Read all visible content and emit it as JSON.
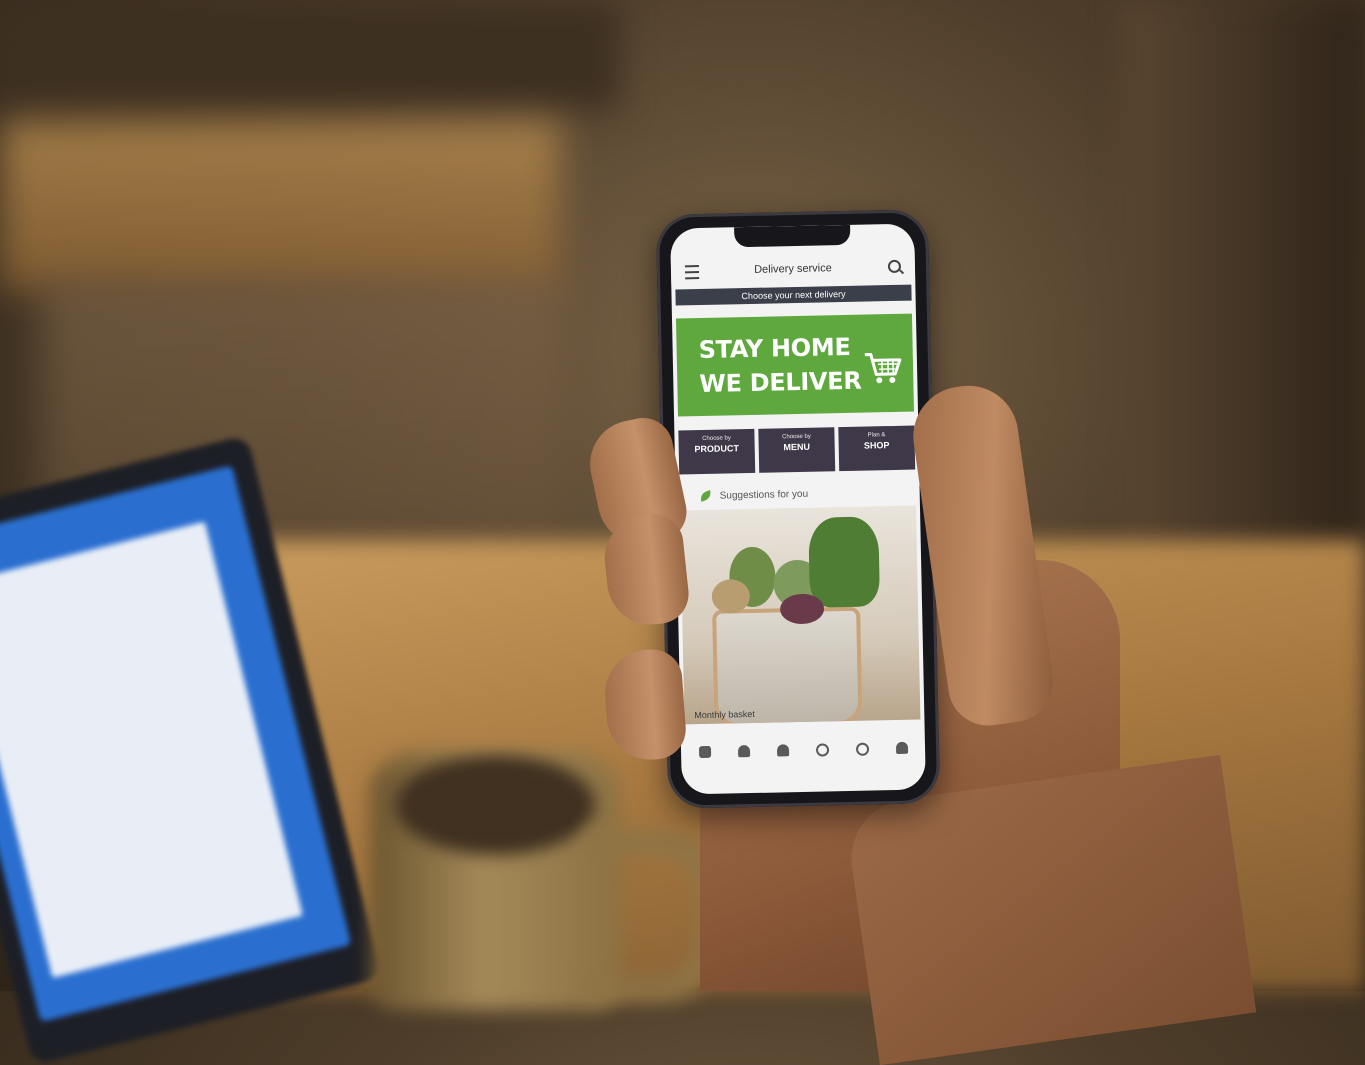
{
  "app": {
    "title": "Delivery service",
    "subtitle": "Choose your next delivery"
  },
  "banner": {
    "line1": "STAY HOME",
    "line2": "WE DELIVER",
    "background_color": "#5ea83e"
  },
  "options": [
    {
      "small": "Choose by",
      "big": "PRODUCT"
    },
    {
      "small": "Choose by",
      "big": "MENU"
    },
    {
      "small": "Plan &",
      "big": "SHOP"
    }
  ],
  "suggestions": {
    "label": "Suggestions for you"
  },
  "photo": {
    "caption": "Monthly basket"
  },
  "icons": {
    "header_left": "menu-icon",
    "header_right": "search-icon",
    "banner": "cart-icon",
    "suggestions": "leaf-icon",
    "tabbar": [
      "flag-icon",
      "bag-icon",
      "pin-icon",
      "globe-icon",
      "compass-icon",
      "user-icon"
    ]
  },
  "colors": {
    "subbar": "#3b3f4a",
    "option_button": "#3f3848"
  }
}
